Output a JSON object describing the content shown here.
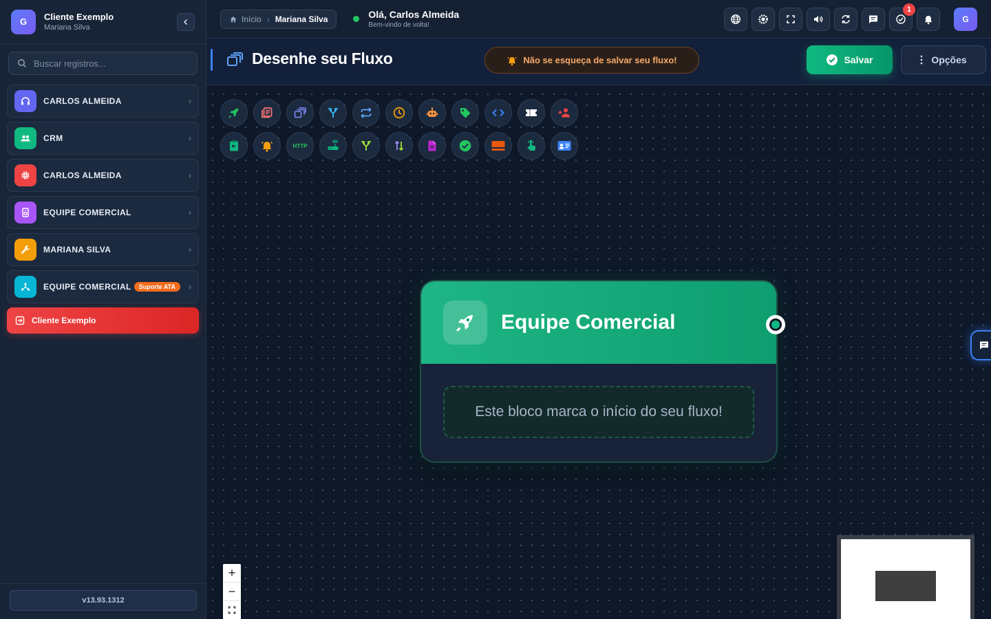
{
  "sidebar": {
    "org": {
      "avatar": "G",
      "name": "Cliente Exemplo",
      "subtitle": "Mariana Silva"
    },
    "search": {
      "placeholder": "Buscar registros..."
    },
    "items": [
      {
        "label": "CARLOS ALMEIDA",
        "icon": "headset-icon",
        "color": "#6366f1"
      },
      {
        "label": "CRM",
        "icon": "users-icon",
        "color": "#10b981"
      },
      {
        "label": "CARLOS ALMEIDA",
        "icon": "gear-icon",
        "color": "#ef4444"
      },
      {
        "label": "EQUIPE COMERCIAL",
        "icon": "speaker-icon",
        "color": "#a855f7"
      },
      {
        "label": "MARIANA SILVA",
        "icon": "wrench-icon",
        "color": "#f59e0b"
      },
      {
        "label": "EQUIPE COMERCIAL",
        "badge": "Suporte ATA",
        "icon": "network-icon",
        "color": "#06b6d4"
      }
    ],
    "active_item": {
      "label": "Cliente Exemplo",
      "icon": "exit-icon"
    },
    "version": "v13.93.1312"
  },
  "topbar": {
    "breadcrumb": {
      "home": "Início",
      "current": "Mariana Silva"
    },
    "greeting": {
      "title": "Olá, Carlos Almeida",
      "subtitle": "Bem-vindo de volta!"
    },
    "actions": [
      "globe-icon",
      "brightness-icon",
      "fullscreen-icon",
      "volume-icon",
      "refresh-icon",
      "chat-icon",
      "task-check-icon",
      "bell-icon"
    ],
    "task_badge": "1",
    "user_avatar": "G"
  },
  "header": {
    "title": "Desenhe seu Fluxo",
    "warning": "Não se esqueça de salvar seu fluxo!",
    "save_label": "Salvar",
    "options_label": "Opções"
  },
  "palette": {
    "row1": [
      "rocket-icon",
      "library-icon",
      "stack-icon",
      "fork-icon",
      "loop-icon",
      "clock-icon",
      "robot-icon",
      "tag-icon",
      "code-icon",
      "ticket-icon",
      "add-user-icon"
    ],
    "row2": [
      "clipboard-icon",
      "alarm-icon",
      "http-icon",
      "router-icon",
      "split-icon",
      "sort-icon",
      "file-icon",
      "check-circle-icon",
      "panel-icon",
      "touch-icon",
      "contact-card-icon"
    ],
    "http_label": "HTTP"
  },
  "node": {
    "title": "Equipe Comercial",
    "description": "Este bloco marca o início do seu fluxo!",
    "color": "#10b981"
  }
}
